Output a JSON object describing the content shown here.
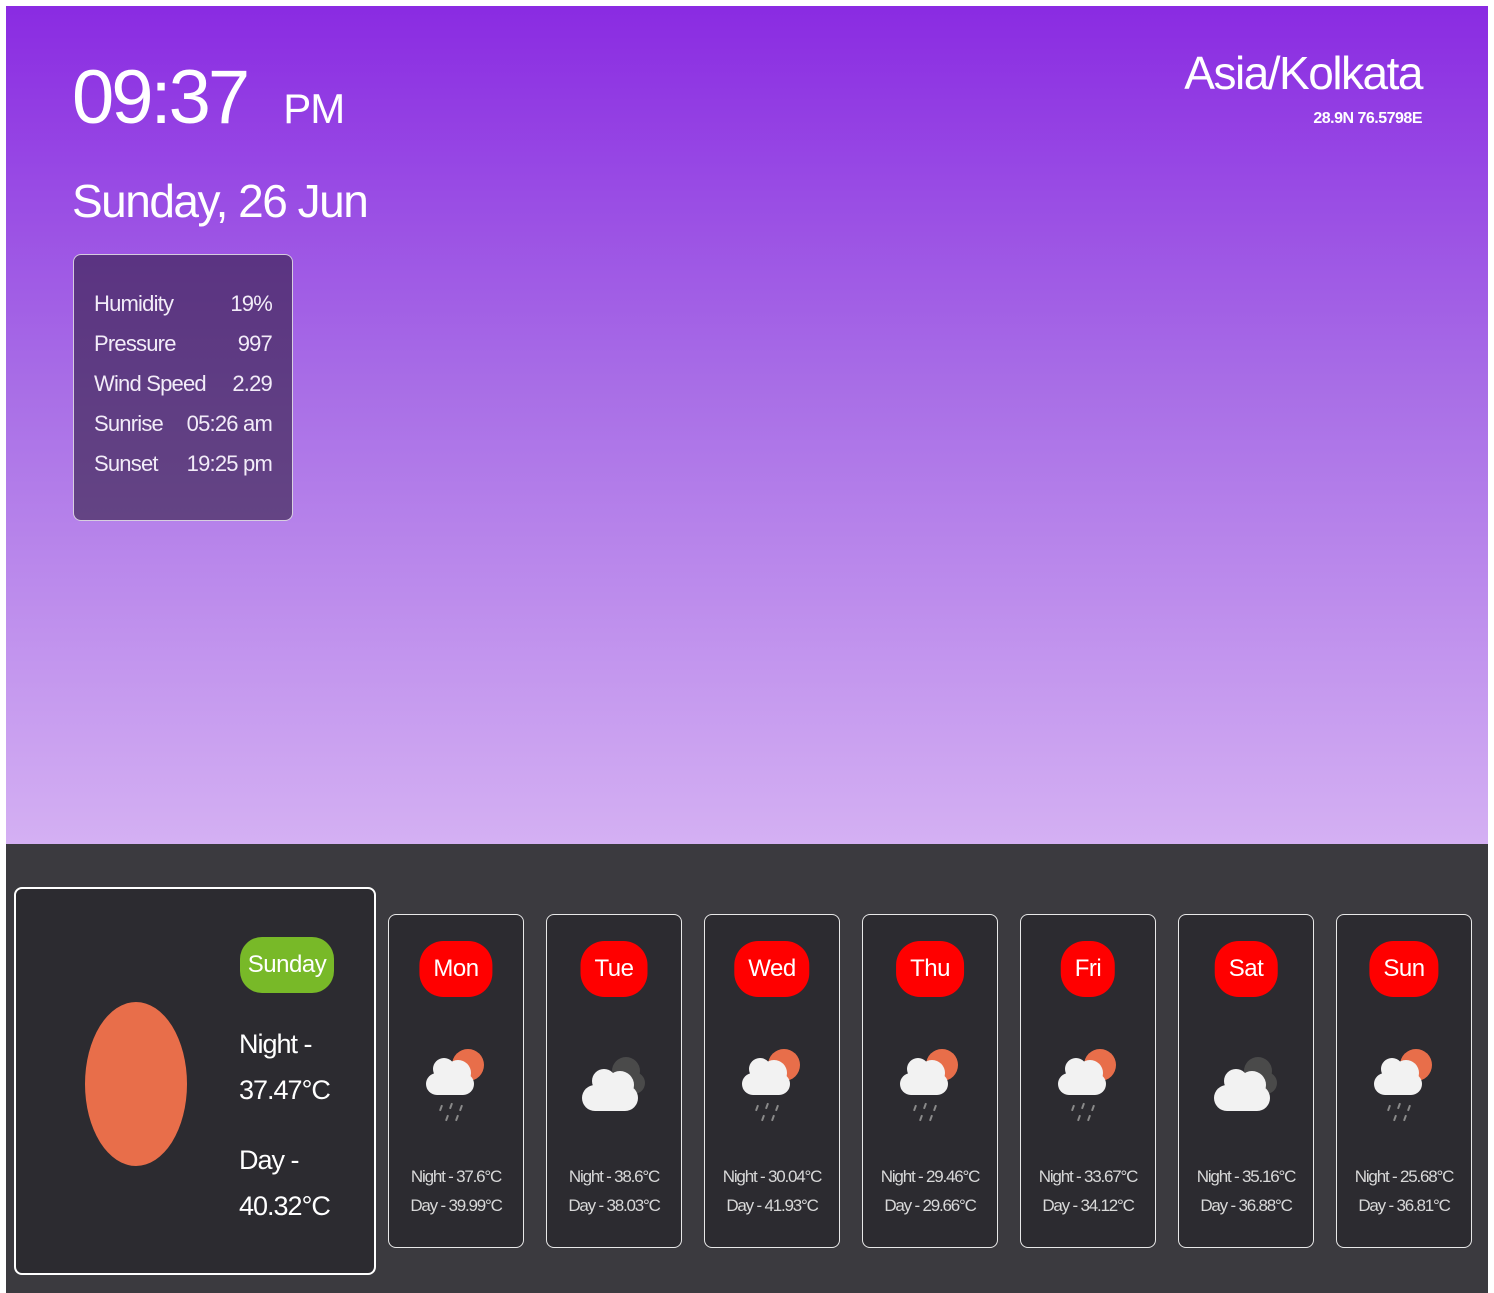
{
  "clock": {
    "time": "09:37",
    "ampm": "PM",
    "date": "Sunday, 26 Jun"
  },
  "stats": [
    {
      "label": "Humidity",
      "value": "19%"
    },
    {
      "label": "Pressure",
      "value": "997"
    },
    {
      "label": "Wind Speed",
      "value": "2.29"
    },
    {
      "label": "Sunrise",
      "value": "05:26 am"
    },
    {
      "label": "Sunset",
      "value": "19:25 pm"
    }
  ],
  "location": {
    "timezone": "Asia/Kolkata",
    "coords": "28.9N 76.5798E"
  },
  "today": {
    "day": "Sunday",
    "night_label": "Night -",
    "night_temp": "37.47°C",
    "day_label": "Day -",
    "day_temp": "40.32°C",
    "icon": "sun-icon"
  },
  "forecast": [
    {
      "day": "Mon",
      "night": "Night - 37.6°C",
      "dayt": "Day - 39.99°C",
      "icon": "cloud-sun-rain-icon"
    },
    {
      "day": "Tue",
      "night": "Night - 38.6°C",
      "dayt": "Day - 38.03°C",
      "icon": "cloud-icon"
    },
    {
      "day": "Wed",
      "night": "Night - 30.04°C",
      "dayt": "Day - 41.93°C",
      "icon": "cloud-sun-rain-icon"
    },
    {
      "day": "Thu",
      "night": "Night - 29.46°C",
      "dayt": "Day - 29.66°C",
      "icon": "cloud-sun-rain-icon"
    },
    {
      "day": "Fri",
      "night": "Night - 33.67°C",
      "dayt": "Day - 34.12°C",
      "icon": "cloud-sun-rain-icon"
    },
    {
      "day": "Sat",
      "night": "Night - 35.16°C",
      "dayt": "Day - 36.88°C",
      "icon": "cloud-icon"
    },
    {
      "day": "Sun",
      "night": "Night - 25.68°C",
      "dayt": "Day - 36.81°C",
      "icon": "cloud-sun-rain-icon"
    }
  ],
  "colors": {
    "gradient_top": "#8a2be2",
    "gradient_bottom": "#d4b0f3",
    "panel": "#3b3a3f",
    "card": "#2c2b30",
    "today_badge": "#78b928",
    "day_badge": "#ff0000",
    "sun": "#e86e4a"
  }
}
